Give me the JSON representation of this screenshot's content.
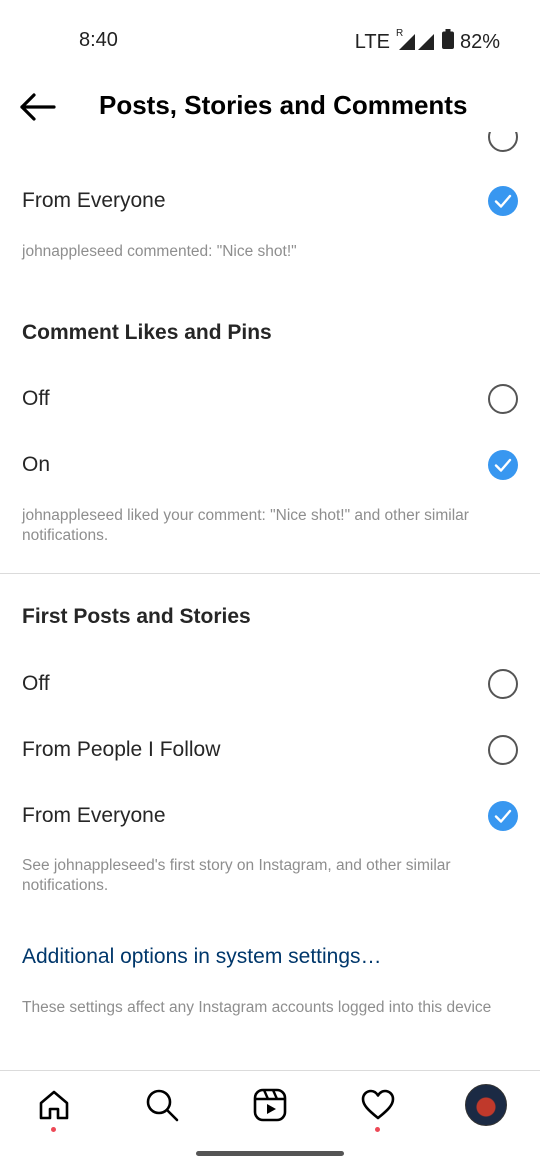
{
  "status_bar": {
    "time": "8:40",
    "network": "LTE",
    "roaming": "R",
    "battery": "82%"
  },
  "header": {
    "title": "Posts, Stories and Comments"
  },
  "comments_section": {
    "option_everyone": "From Everyone",
    "description": "johnappleseed commented: \"Nice shot!\""
  },
  "comment_likes": {
    "title": "Comment Likes and Pins",
    "options": [
      {
        "label": "Off",
        "checked": false
      },
      {
        "label": "On",
        "checked": true
      }
    ],
    "description": "johnappleseed liked your comment: \"Nice shot!\" and other similar notifications."
  },
  "first_posts": {
    "title": "First Posts and Stories",
    "options": [
      {
        "label": "Off",
        "checked": false
      },
      {
        "label": "From People I Follow",
        "checked": false
      },
      {
        "label": "From Everyone",
        "checked": true
      }
    ],
    "description": "See johnappleseed's first story on Instagram, and other similar notifications."
  },
  "additional_link": "Additional options in system settings…",
  "footer_note": "These settings affect any Instagram accounts logged into this device",
  "tabbar": {
    "items": [
      "home-icon",
      "search-icon",
      "reels-icon",
      "heart-icon",
      "profile-avatar"
    ]
  },
  "colors": {
    "accent": "#3897f0",
    "link": "#00376b",
    "notification_dot": "#ed4956"
  }
}
